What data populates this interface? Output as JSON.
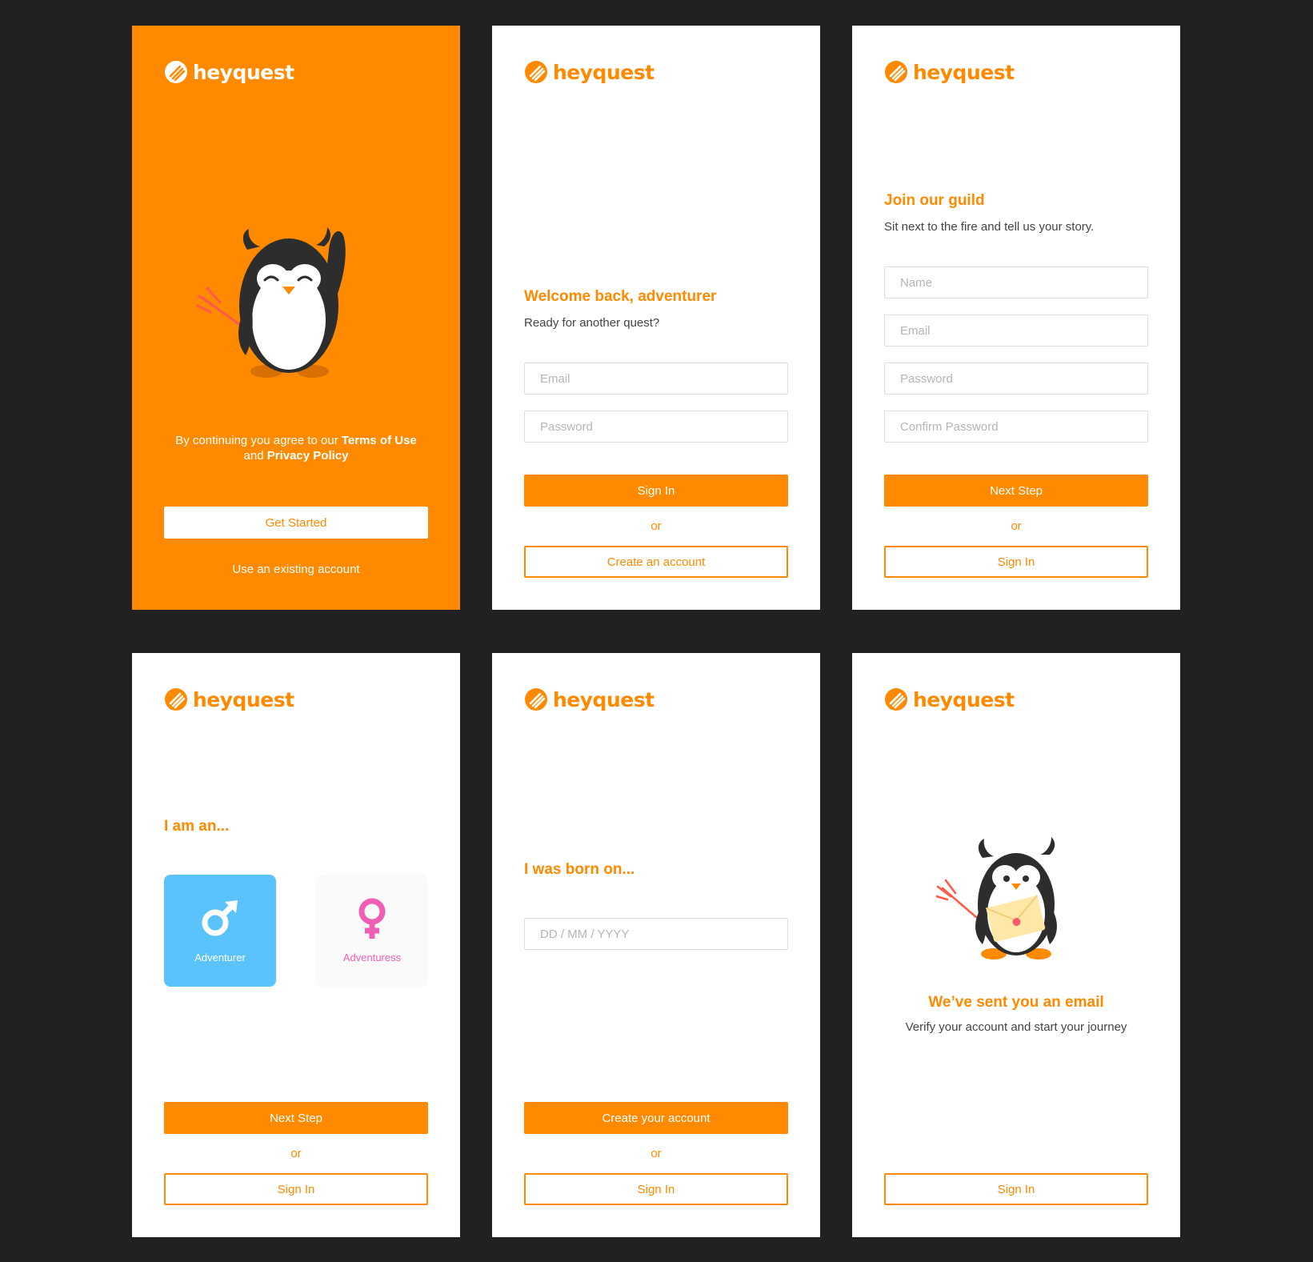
{
  "brand": {
    "name": "heyquest",
    "color": "#ff8a00",
    "logo_icon": "heyquest-logo-icon"
  },
  "welcome": {
    "legal_prefix": "By continuing you agree to our",
    "terms_link": "Terms of Use",
    "legal_and": "and",
    "privacy_link": "Privacy Policy",
    "get_started": "Get Started",
    "existing_account": "Use an existing account",
    "illustration": "waving-devil-penguin"
  },
  "signin": {
    "title": "Welcome back, adventurer",
    "subtitle": "Ready for another quest?",
    "email_placeholder": "Email",
    "password_placeholder": "Password",
    "sign_in": "Sign In",
    "or": "or",
    "create_account": "Create an account"
  },
  "register": {
    "title": "Join our guild",
    "subtitle": "Sit next to the fire and tell us your story.",
    "name_placeholder": "Name",
    "email_placeholder": "Email",
    "password_placeholder": "Password",
    "confirm_placeholder": "Confirm Password",
    "next_step": "Next Step",
    "or": "or",
    "sign_in": "Sign In"
  },
  "gender": {
    "title": "I am an...",
    "male_label": "Adventurer",
    "female_label": "Adventuress",
    "selected": "Adventurer",
    "male_color": "#5bc3fb",
    "female_color": "#f05fb4",
    "next_step": "Next Step",
    "or": "or",
    "sign_in": "Sign In"
  },
  "birthday": {
    "title": "I was born on...",
    "date_placeholder": "DD / MM / YYYY",
    "create_account": "Create your account",
    "or": "or",
    "sign_in": "Sign In"
  },
  "email_sent": {
    "title": "We’ve sent you an email",
    "subtitle": "Verify your account and start your journey",
    "sign_in": "Sign In",
    "illustration": "penguin-with-envelope"
  }
}
